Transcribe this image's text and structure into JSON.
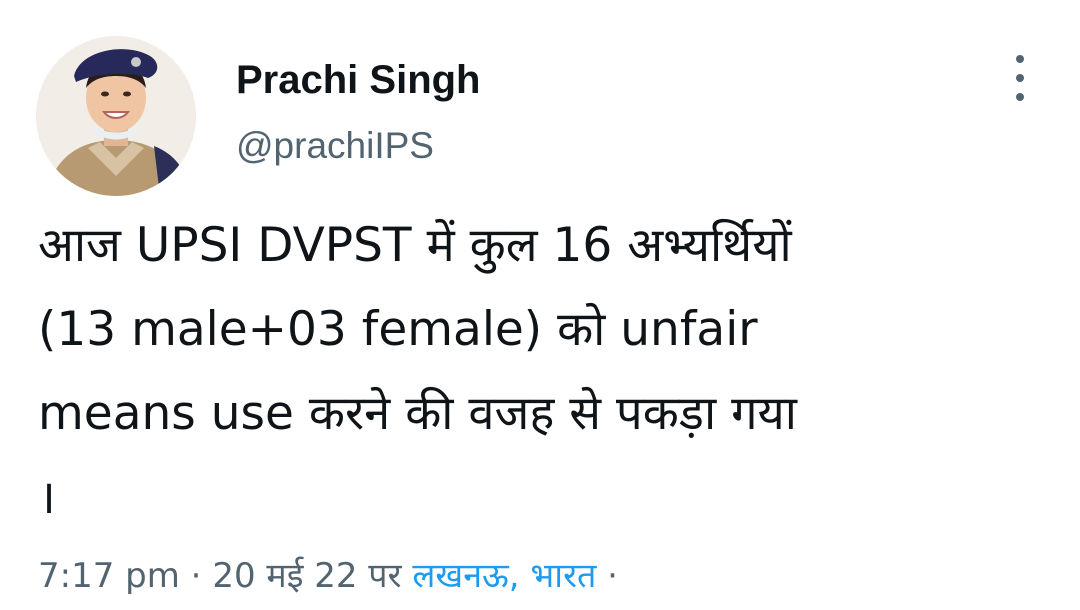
{
  "author": {
    "display_name": "Prachi Singh",
    "handle": "@prachiIPS",
    "avatar_icon": "profile-photo-police-officer"
  },
  "more_icon": "more-vertical-icon",
  "tweet": {
    "lines": [
      "आज UPSI DVPST में कुल 16 अभ्यर्थियों",
      "(13 male+03 female) को unfair",
      "means use करने की वजह से पकड़ा गया",
      "।"
    ]
  },
  "meta": {
    "time": "7:17 pm",
    "sep1": " · ",
    "date": "20 मई 22 पर",
    "location": "लखनऊ, भारत",
    "sep2": " ·"
  },
  "colors": {
    "text_primary": "#0f1419",
    "text_secondary": "#536471",
    "link": "#1d9bf0"
  }
}
